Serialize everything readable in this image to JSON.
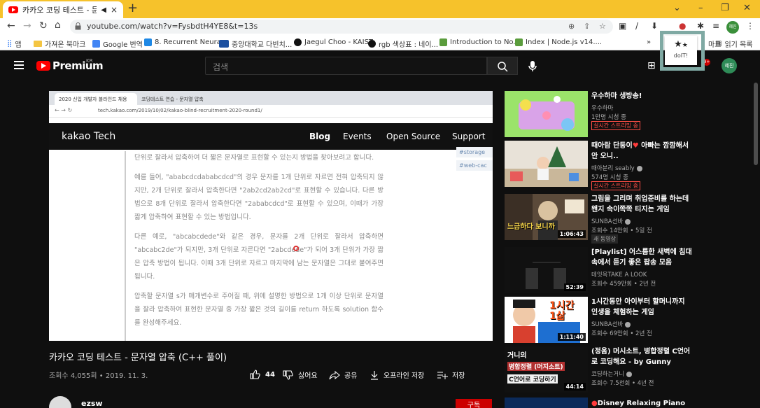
{
  "browser": {
    "tab": {
      "title": "카카오 코딩 테스트 - 문자열",
      "audio_icon": "speaker-icon",
      "close": "×"
    },
    "new_tab": "+",
    "window_controls": {
      "minimize": "–",
      "maximize": "❐",
      "close": "✕",
      "tab_search": "⌄"
    },
    "url": "youtube.com/watch?v=FysbdtH4YE8&t=13s",
    "bookmarks": [
      {
        "label": "앱",
        "icon": "apps-icon"
      },
      {
        "label": "가져온 북마크",
        "icon": "folder-icon"
      },
      {
        "label": "Google 번역",
        "icon": "translate-icon"
      },
      {
        "label": "8. Recurrent Neura...",
        "icon": "page-icon"
      },
      {
        "label": "중앙대학교 다빈치...",
        "icon": "cau-icon"
      },
      {
        "label": "Jaegul Choo - KAIST",
        "icon": "github-icon"
      },
      {
        "label": "rgb 색상표 : 네이...",
        "icon": "naver-icon"
      },
      {
        "label": "Introduction to No...",
        "icon": "node-icon"
      },
      {
        "label": "Index | Node.js v14....",
        "icon": "node-icon"
      },
      {
        "label": "»",
        "icon": "chevron-icon"
      },
      {
        "label": "읽기 목록",
        "icon": "reading-list-icon"
      }
    ],
    "bookmark_partial": "마크",
    "popup": {
      "label": "doIT!",
      "icon": "doit-stars-icon"
    },
    "profile_label": "혜진"
  },
  "youtube": {
    "brand": "Premium",
    "region": "KR",
    "search_placeholder": "검색",
    "avatar": "혜진",
    "notifications": "9+"
  },
  "player": {
    "inner_tabs": [
      {
        "label": "2020 신입 개발자 블라인드 채용"
      },
      {
        "label": "코딩테스트 연습 - 문자열 압축"
      }
    ],
    "inner_url": "tech.kakao.com/2019/10/02/kakao-blind-recruitment-2020-round1/",
    "site_logo": "kakao Tech",
    "nav": [
      "Blog",
      "Events",
      "Open Source",
      "Support"
    ],
    "tags": [
      "#storage",
      "#web-cac"
    ],
    "paragraphs": [
      "단위로 잘라서 압축하여 더 짧은 문자열로 표현할 수 있는지 방법을 찾아보려고 합니다.",
      "예를 들어, \"ababcdcdababcdcd\"의 경우 문자를 1개 단위로 자르면 전혀 압축되지 않지만, 2개 단위로 잘라서 압축한다면 \"2ab2cd2ab2cd\"로 표현할 수 있습니다. 다른 방법으로 8개 단위로 잘라서 압축한다면 \"2ababcdcd\"로 표현할 수 있으며, 이때가 가장 짧게 압축하여 표현할 수 있는 방법입니다.",
      "다른 예로, \"abcabcdede\"와 같은 경우, 문자를 2개 단위로 잘라서 압축하면 \"abcabc2de\"가 되지만, 3개 단위로 자른다면 \"2abcdede\"가 되어 3개 단위가 가장 짧은 압축 방법이 됩니다. 이때 3개 단위로 자르고 마지막에 남는 문자열은 그대로 붙여주면 됩니다.",
      "압축할 문자열 s가 매개변수로 주어질 때, 위에 설명한 방법으로 1개 이상 단위로 문자열을 잘라 압축하여 표현한 문자열 중 가장 짧은 것의 길이를 return 하도록 solution 함수를 완성해주세요."
    ]
  },
  "video": {
    "title": "카카오 코딩 테스트 - 문자열 압축 (C++ 풀이)",
    "meta": "조회수 4,055회 • 2019. 11. 3.",
    "likes": "44",
    "dislike_label": "싫어요",
    "share_label": "공유",
    "download_label": "오프라인 저장",
    "save_label": "저장",
    "channel": "ezsw",
    "subscribe": "구독"
  },
  "recommendations": [
    {
      "title": "우수하마 생방송!",
      "channel": "우수하마",
      "views": "1만명 시청 중",
      "badge": "실시간 스트리밍 중",
      "badge_type": "live",
      "duration": ""
    },
    {
      "title_pre": "때아람 단둥이",
      "title_post": " 아빠는 깜깜해서 안 오니..",
      "channel": "때아분리 seably",
      "views": "574명 시청 중",
      "badge": "실시간 스트리밍 중",
      "badge_type": "live",
      "duration": ""
    },
    {
      "title": "그림을 그리며 취업준비를 하는데 왠지 속이쪽쪽 티지는 게임",
      "channel": "SUNBA선바",
      "views": "조회수 14만회 • 5일 전",
      "badge": "새 동영상",
      "badge_type": "new",
      "duration": "1:06:43"
    },
    {
      "title": "[Playlist] 어스름한 새벽에 침대 속에서 듣기 좋은 팝송 모음",
      "channel": "테잇옥TAKE A LOOK",
      "views": "조회수 459만회 • 2년 전",
      "badge": "",
      "badge_type": "",
      "duration": "52:39"
    },
    {
      "title": "1시간동안 아이부터 할머니까지 인생을 체험하는 게임",
      "channel": "SUNBA선바",
      "views": "조회수 69만회 • 2년 전",
      "badge": "",
      "badge_type": "",
      "duration": "1:11:40"
    },
    {
      "title": "(정옴) 머시소트, 병합정렬 C언어로 코딩해요 - by Gunny",
      "channel": "코딩하는거니",
      "views": "조회수 7.5천회 • 4년 전",
      "badge": "",
      "badge_type": "",
      "duration": "44:14"
    },
    {
      "title": "Disney Relaxing Piano",
      "channel": "",
      "views": "",
      "badge": "",
      "badge_type": "",
      "duration": ""
    }
  ],
  "thumb_text": {
    "rec3": "느금하다 보니까",
    "rec5": "1시간 1삶",
    "rec6_a": "거니의",
    "rec6_b": "병합정렬 (머지소트)",
    "rec6_c": "C언어로 코딩하기"
  },
  "colors": {
    "tab_bar": "#f6c22b",
    "youtube_red": "#ff0000",
    "popup_frame": "#7fa9a3",
    "live_red": "#ff4e45"
  }
}
